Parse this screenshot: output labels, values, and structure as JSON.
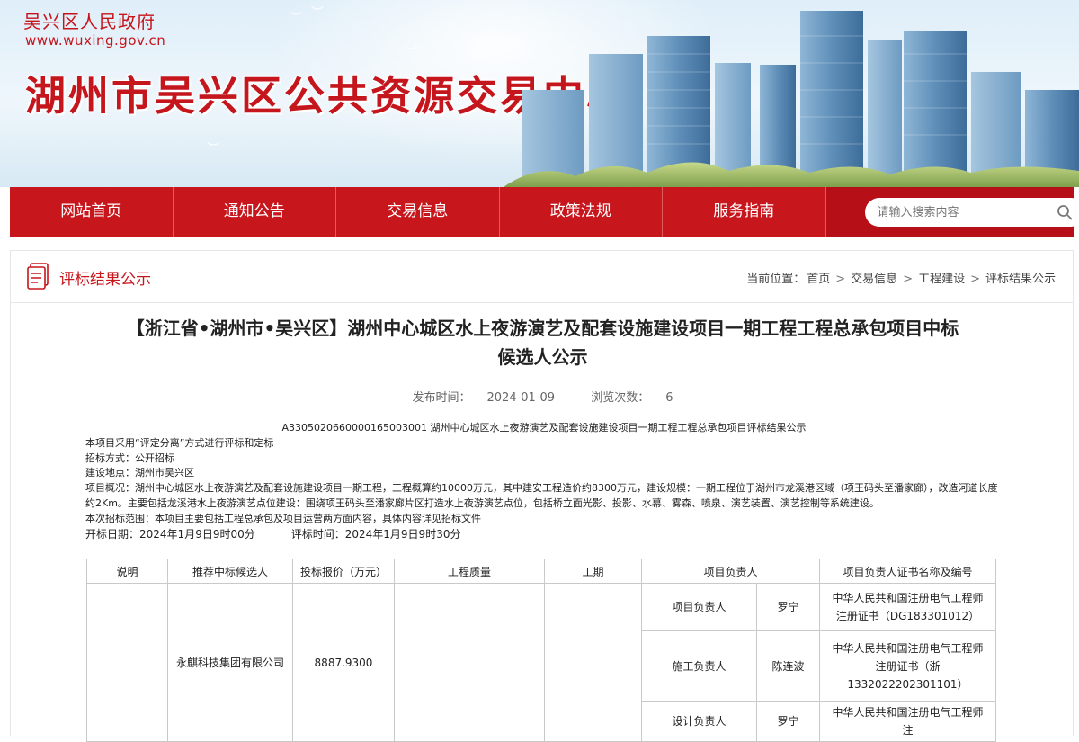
{
  "header": {
    "gov_name": "吴兴区人民政府",
    "gov_url": "www.wuxing.gov.cn",
    "site_title": "湖州市吴兴区公共资源交易中心"
  },
  "nav": {
    "items": [
      "网站首页",
      "通知公告",
      "交易信息",
      "政策法规",
      "服务指南"
    ],
    "search_placeholder": "请输入搜索内容"
  },
  "section": {
    "title": "评标结果公示",
    "breadcrumb_prefix": "当前位置：",
    "breadcrumb": [
      "首页",
      "交易信息",
      "工程建设",
      "评标结果公示"
    ]
  },
  "article": {
    "title_line1": "【浙江省•湖州市•吴兴区】湖州中心城区水上夜游演艺及配套设施建设项目一期工程工程总承包项目中标",
    "title_line2": "候选人公示",
    "publish_label": "发布时间：",
    "publish_date": "2024-01-09",
    "views_label": "浏览次数：",
    "views": "6",
    "code_line": "A3305020660000165003001 湖州中心城区水上夜游演艺及配套设施建设项目一期工程工程总承包项目评标结果公示",
    "lines": [
      "本项目采用“评定分离”方式进行评标和定标",
      "招标方式：公开招标",
      "建设地点：湖州市吴兴区",
      "项目概况：湖州中心城区水上夜游演艺及配套设施建设项目一期工程，工程概算约10000万元，其中建安工程造价约8300万元，建设规模：一期工程位于湖州市龙溪港区域（项王码头至潘家廊），改造河道长度约2Km。主要包括龙溪港水上夜游演艺点位建设：围绕项王码头至潘家廊片区打造水上夜游演艺点位，包括桥立面光影、投影、水幕、雾森、喷泉、演艺装置、演艺控制等系统建设。",
      "本次招标范围：本项目主要包括工程总承包及项目运营两方面内容，具体内容详见招标文件"
    ],
    "open_date_label": "开标日期：",
    "open_date": "2024年1月9日9时00分",
    "eval_time_label": "评标时间：",
    "eval_time": "2024年1月9日9时30分"
  },
  "table": {
    "headers": [
      "说明",
      "推荐中标候选人",
      "投标报价（万元）",
      "工程质量",
      "工期",
      "项目负责人",
      "项目负责人证书名称及编号"
    ],
    "candidate": "永麒科技集团有限公司",
    "bid_price": "8887.9300",
    "persons": [
      {
        "role": "项目负责人",
        "name": "罗宁",
        "cert": "中华人民共和国注册电气工程师注册证书（DG183301012）"
      },
      {
        "role": "施工负责人",
        "name": "陈连波",
        "cert": "中华人民共和国注册电气工程师注册证书（浙1332022202301101）"
      },
      {
        "role": "设计负责人",
        "name": "罗宁",
        "cert": "中华人民共和国注册电气工程师注"
      }
    ]
  },
  "colors": {
    "brand_red": "#c8161d",
    "nav_search_bg": "#b70f17"
  }
}
